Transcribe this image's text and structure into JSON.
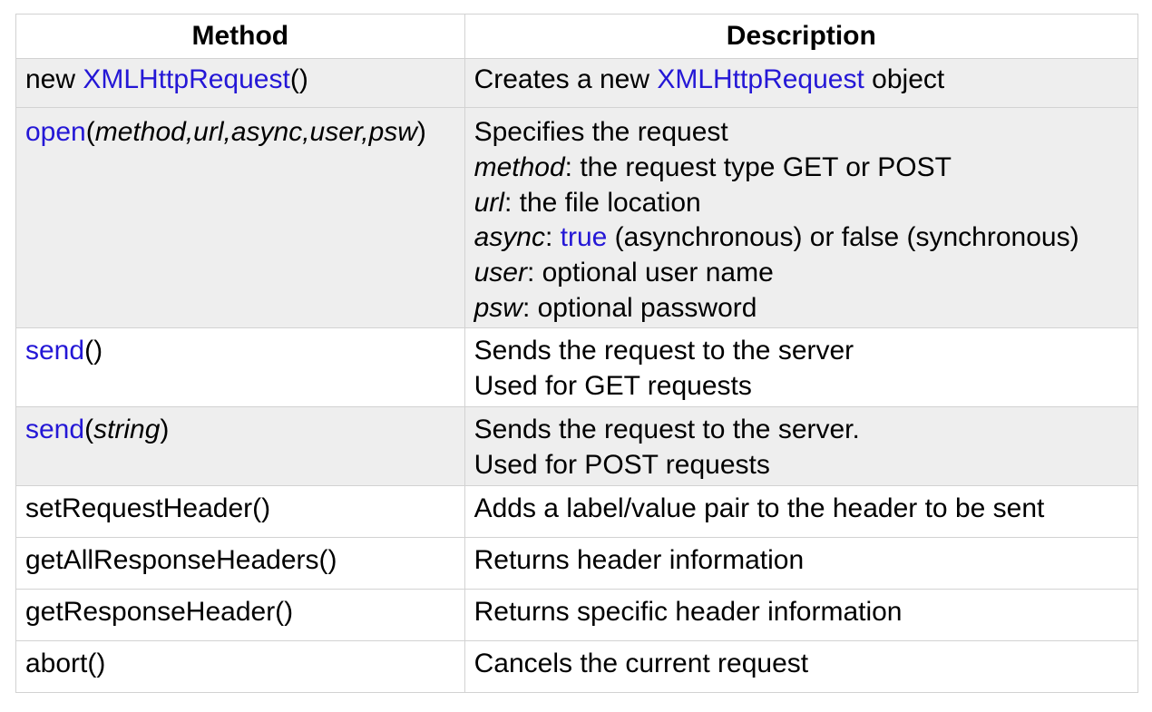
{
  "headers": {
    "method": "Method",
    "description": "Description"
  },
  "rows": [
    {
      "method": {
        "prefix": "new ",
        "name": "XMLHttpRequest",
        "open": "(",
        "args": "",
        "close": ")"
      },
      "description": {
        "before": "Creates a new ",
        "keyword": "XMLHttpRequest",
        "after": " object"
      }
    },
    {
      "method": {
        "name": "open",
        "open": "(",
        "args": "method,url,async,user,psw",
        "close": ")"
      },
      "description": {
        "intro": "Specifies the request",
        "params": [
          {
            "name": "method",
            "text": ": the request type GET or POST"
          },
          {
            "name": "url",
            "text": ": the file location"
          },
          {
            "name": "async",
            "sep": ": ",
            "keyword": "true",
            "text": " (asynchronous) or false (synchronous)"
          },
          {
            "name": "user",
            "text": ": optional user name"
          },
          {
            "name": "psw",
            "text": ": optional password"
          }
        ]
      }
    },
    {
      "method": {
        "name": "send",
        "open": "(",
        "args": "",
        "close": ")"
      },
      "description": {
        "lines": [
          "Sends the request to the server",
          "Used for GET requests"
        ]
      }
    },
    {
      "method": {
        "name": "send",
        "open": "(",
        "args": "string",
        "close": ")"
      },
      "description": {
        "lines": [
          "Sends the request to the server.",
          "Used for POST requests"
        ]
      }
    },
    {
      "method": {
        "text": "setRequestHeader()"
      },
      "description": {
        "text": "Adds a label/value pair to the header to be sent"
      }
    },
    {
      "method": {
        "text": "getAllResponseHeaders()"
      },
      "description": {
        "text": "Returns header information"
      }
    },
    {
      "method": {
        "text": "getResponseHeader()"
      },
      "description": {
        "text": "Returns specific header information"
      }
    },
    {
      "method": {
        "text": "abort()"
      },
      "description": {
        "text": "Cancels the current request"
      }
    }
  ],
  "colors": {
    "keyword": "#2417d6",
    "row_shade": "#eeeeee",
    "border": "#d2d2d2"
  }
}
